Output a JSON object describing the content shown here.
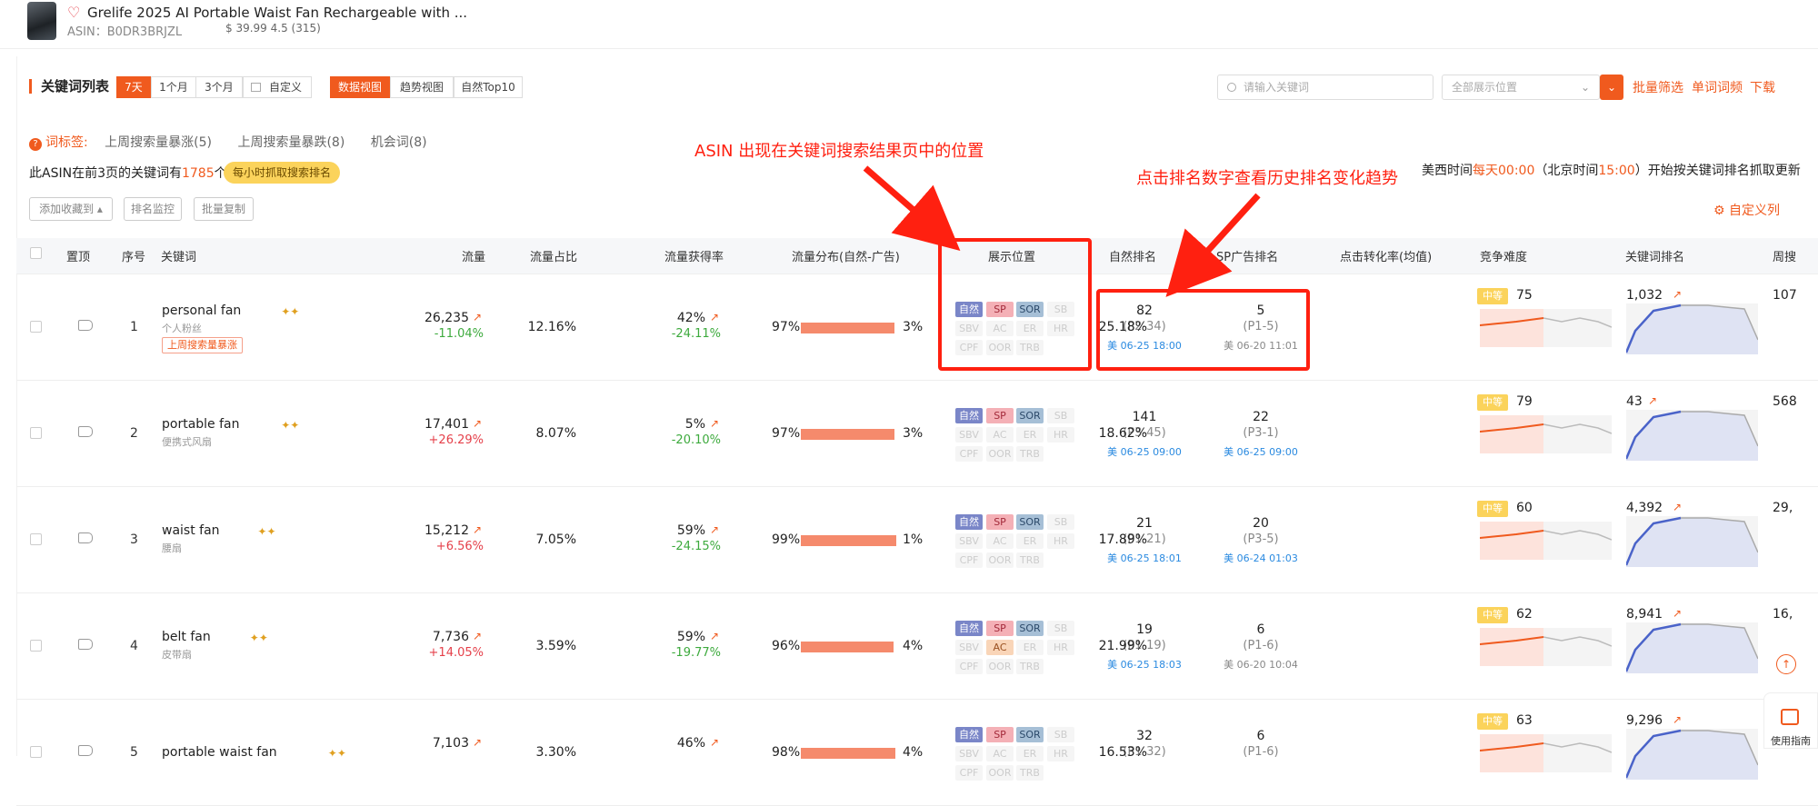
{
  "product": {
    "title": "Grelife 2025 AI Portable Waist Fan Rechargeable with ...",
    "asin": "ASIN：B0DR3BRJZL",
    "price_rating": "$ 39.99  4.5 (315)"
  },
  "toolbar": {
    "title": "关键词列表",
    "periods": [
      "7天",
      "1个月",
      "3个月",
      "自定义"
    ],
    "views": [
      "数据视图",
      "趋势视图",
      "自然Top10"
    ],
    "search_placeholder": "请输入关键词",
    "position_select": "全部展示位置",
    "links": [
      "批量筛选",
      "单词词频",
      "下载"
    ]
  },
  "tags": {
    "label": "词标签:",
    "items": [
      "上周搜索量暴涨(5)",
      "上周搜索量暴跌(8)",
      "机会词(8)"
    ]
  },
  "summary": {
    "prefix": "此ASIN在前3页的关键词有",
    "count": "1785",
    "suffix": "个",
    "hourly_badge": "每小时抓取搜索排名"
  },
  "time_info": {
    "a": "美西时间",
    "b": "每天00:00",
    "c": "（北京时间",
    "d": "15:00",
    "e": "）开始按关键词排名抓取更新"
  },
  "actions": [
    "添加收藏到 ▴",
    "排名监控",
    "批量复制"
  ],
  "custom_columns": "自定义列",
  "columns": [
    "置顶",
    "序号",
    "关键词",
    "流量",
    "流量占比",
    "流量获得率",
    "流量分布(自然-广告)",
    "展示位置",
    "自然排名",
    "SP广告排名",
    "点击转化率(均值)",
    "竞争难度",
    "关键词排名",
    "周搜"
  ],
  "badge_labels": [
    "自然",
    "SP",
    "SOR",
    "SB",
    "SBV",
    "AC",
    "ER",
    "HR",
    "CPF",
    "OOR",
    "TRB"
  ],
  "rows": [
    {
      "seq": "1",
      "keyword": "personal fan",
      "zh": "个人粉丝",
      "hot": "上周搜索量暴涨",
      "traffic": "26,235",
      "traffic_chg": "-11.04%",
      "share": "12.16%",
      "rate": "42%",
      "rate_chg": "-24.11%",
      "dist_left": "97%",
      "dist_right": "3%",
      "org_rank": "82",
      "org_page": "(P2-34)",
      "org_time": "美 06-25 18:00",
      "sp_rank": "5",
      "sp_page": "(P1-5)",
      "sp_time": "美 06-20 11:01",
      "ctr": "25.18%",
      "level": "中等",
      "difficulty": "75",
      "kw_rank": "1,032",
      "weekly": "107"
    },
    {
      "seq": "2",
      "keyword": "portable fan",
      "zh": "便携式风扇",
      "hot": "",
      "traffic": "17,401",
      "traffic_chg": "+26.29%",
      "share": "8.07%",
      "rate": "5%",
      "rate_chg": "-20.10%",
      "dist_left": "97%",
      "dist_right": "3%",
      "org_rank": "141",
      "org_page": "(P3-45)",
      "org_time": "美 06-25 09:00",
      "sp_rank": "22",
      "sp_page": "(P3-1)",
      "sp_time": "美 06-25 09:00",
      "ctr": "18.62%",
      "level": "中等",
      "difficulty": "79",
      "kw_rank": "43",
      "weekly": "568"
    },
    {
      "seq": "3",
      "keyword": "waist fan",
      "zh": "腰扇",
      "hot": "",
      "traffic": "15,212",
      "traffic_chg": "+6.56%",
      "share": "7.05%",
      "rate": "59%",
      "rate_chg": "-24.15%",
      "dist_left": "99%",
      "dist_right": "1%",
      "org_rank": "21",
      "org_page": "(P1-21)",
      "org_time": "美 06-25 18:01",
      "sp_rank": "20",
      "sp_page": "(P3-5)",
      "sp_time": "美 06-24 01:03",
      "ctr": "17.89%",
      "level": "中等",
      "difficulty": "60",
      "kw_rank": "4,392",
      "weekly": "29,"
    },
    {
      "seq": "4",
      "keyword": "belt fan",
      "zh": "皮带扇",
      "hot": "",
      "traffic": "7,736",
      "traffic_chg": "+14.05%",
      "share": "3.59%",
      "rate": "59%",
      "rate_chg": "-19.77%",
      "dist_left": "96%",
      "dist_right": "4%",
      "org_rank": "19",
      "org_page": "(P1-19)",
      "org_time": "美 06-25 18:03",
      "sp_rank": "6",
      "sp_page": "(P1-6)",
      "sp_time": "美 06-20 10:04",
      "ctr": "21.99%",
      "level": "中等",
      "difficulty": "62",
      "kw_rank": "8,941",
      "weekly": "16,"
    },
    {
      "seq": "5",
      "keyword": "portable waist fan",
      "zh": "",
      "hot": "",
      "traffic": "7,103",
      "traffic_chg": "",
      "share": "3.30%",
      "rate": "46%",
      "rate_chg": "",
      "dist_left": "98%",
      "dist_right": "4%",
      "org_rank": "32",
      "org_page": "(P1-32)",
      "org_time": "",
      "sp_rank": "6",
      "sp_page": "(P1-6)",
      "sp_time": "",
      "ctr": "16.53%",
      "level": "中等",
      "difficulty": "63",
      "kw_rank": "9,296",
      "weekly": ""
    }
  ],
  "annotations": {
    "a1": "ASIN 出现在关键词搜索结果页中的位置",
    "a2": "点击排名数字查看历史排名变化趋势"
  },
  "guide": "使用指南",
  "colors": {
    "accent": "#f05a1e",
    "annotation": "#ff2010",
    "positive": "#e5404a",
    "negative": "#3daa3d",
    "link_blue": "#2a8ae0"
  }
}
